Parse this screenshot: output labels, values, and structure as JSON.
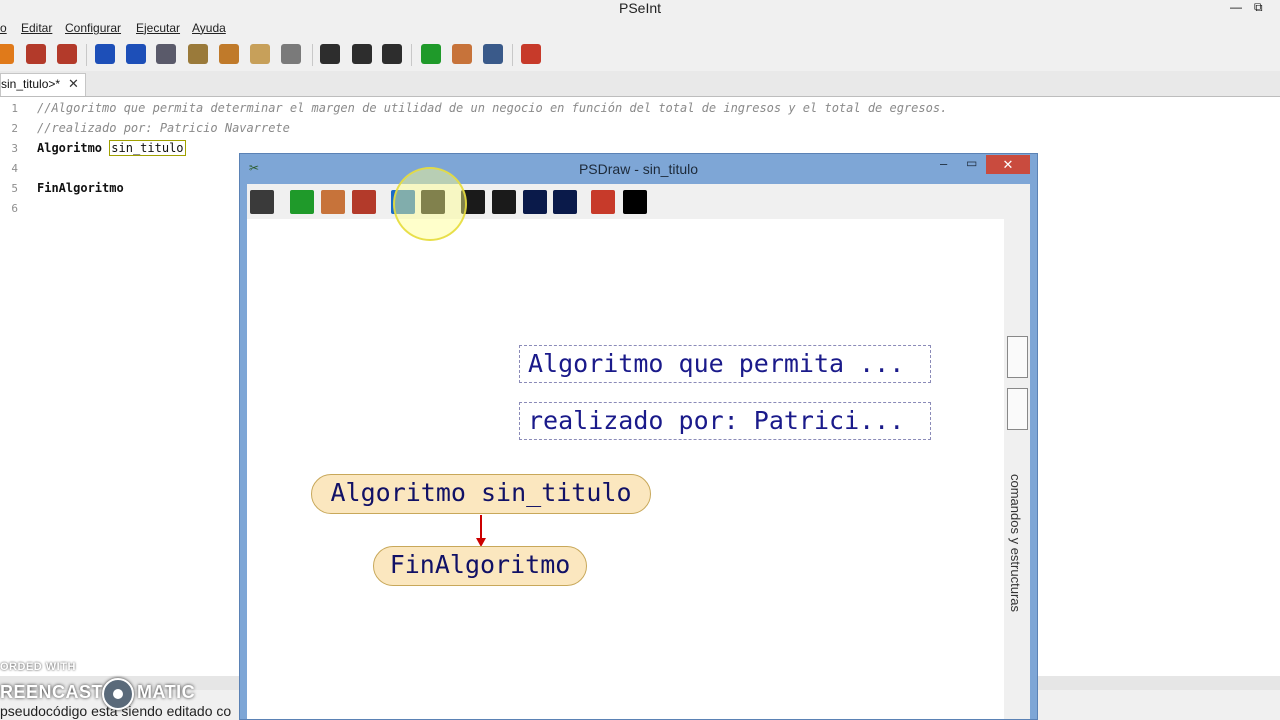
{
  "window": {
    "title": "PSeInt"
  },
  "menu": {
    "items": [
      "o",
      "Editar",
      "Configurar",
      "Ejecutar",
      "Ayuda"
    ]
  },
  "toolbar": {
    "icons": [
      {
        "name": "new-file-icon",
        "color": "#e07a1a"
      },
      {
        "name": "save-icon",
        "color": "#b33a2a"
      },
      {
        "name": "save-as-icon",
        "color": "#b33a2a"
      },
      {
        "name": "undo-icon",
        "color": "#1d4fb8"
      },
      {
        "name": "redo-icon",
        "color": "#1d4fb8"
      },
      {
        "name": "cut-icon",
        "color": "#5a5a6a"
      },
      {
        "name": "copy-icon",
        "color": "#9a7a3a"
      },
      {
        "name": "paste-icon",
        "color": "#c07a2a"
      },
      {
        "name": "correct-indent-icon",
        "color": "#c7a05a"
      },
      {
        "name": "find-icon",
        "color": "#7a7a7a"
      },
      {
        "name": "search-icon",
        "color": "#2d2d2d"
      },
      {
        "name": "search-previous-icon",
        "color": "#2d2d2d"
      },
      {
        "name": "search-next-icon",
        "color": "#2d2d2d"
      },
      {
        "name": "run-icon",
        "color": "#1f9a2a"
      },
      {
        "name": "step-by-step-icon",
        "color": "#c7733a"
      },
      {
        "name": "draw-diagram-icon",
        "color": "#3a5a8a"
      },
      {
        "name": "help-icon",
        "color": "#c73a2a"
      }
    ]
  },
  "tabs": [
    {
      "label": "sin_titulo>*",
      "close": "✕"
    }
  ],
  "editor": {
    "lines": [
      {
        "num": "1",
        "text": "//Algoritmo que permita determinar el margen de utilidad de un negocio en función del total de ingresos y el total de egresos.",
        "kind": "comment"
      },
      {
        "num": "2",
        "text": "//realizado por: Patricio Navarrete",
        "kind": "comment"
      },
      {
        "num": "3",
        "keyword": "Algoritmo",
        "ident": "sin_titulo",
        "kind": "code"
      },
      {
        "num": "4",
        "text": "",
        "kind": "blank"
      },
      {
        "num": "5",
        "keyword": "FinAlgoritmo",
        "kind": "code"
      },
      {
        "num": "6",
        "text": "",
        "kind": "blank"
      }
    ]
  },
  "status": {
    "text": "pseudocódigo está siendo editado co",
    "watermark_top": "ORDED WITH",
    "watermark_left": "REENCAST",
    "watermark_right": "MATIC"
  },
  "psdraw": {
    "title": "PSDraw - sin_titulo",
    "min": "–",
    "max": "▭",
    "close": "✕",
    "tools": [
      {
        "name": "sub-process-icon",
        "color": "#3a3a3a"
      },
      {
        "name": "run-icon",
        "color": "#1f9a2a"
      },
      {
        "name": "step-icon",
        "color": "#c7733a"
      },
      {
        "name": "save-icon",
        "color": "#b33a2a"
      },
      {
        "name": "zoom-icon",
        "color": "#1a6ac7"
      },
      {
        "name": "fit-icon",
        "color": "#1a1a1a"
      },
      {
        "name": "cursor-icon",
        "color": "#1a1a1a"
      },
      {
        "name": "pin-icon",
        "color": "#1a1a1a"
      },
      {
        "name": "expand-icon",
        "color": "#0a1a4a"
      },
      {
        "name": "color-icon",
        "color": "#0a1a4a"
      },
      {
        "name": "help-icon",
        "color": "#c73a2a"
      },
      {
        "name": "blank-icon",
        "color": "#000000"
      }
    ],
    "sidebar_label": "comandos y estructuras",
    "comments": [
      "Algoritmo que permita ...",
      "realizado por: Patrici..."
    ],
    "nodes": {
      "start": "Algoritmo sin_titulo",
      "end": "FinAlgoritmo"
    }
  }
}
